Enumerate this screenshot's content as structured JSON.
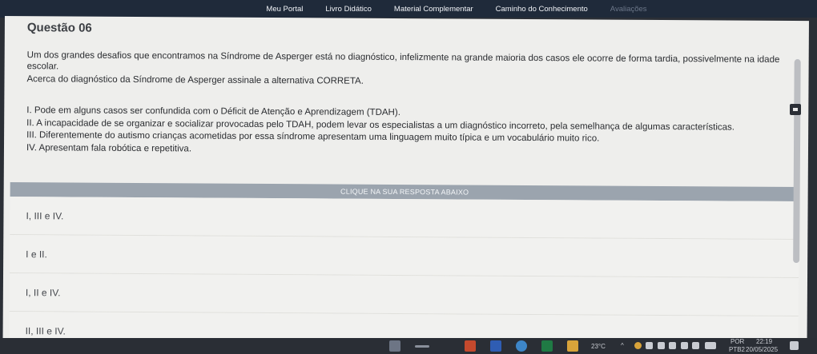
{
  "nav": {
    "items": [
      "Meu Portal",
      "Livro Didático",
      "Material Complementar",
      "Caminho do Conhecimento",
      "Avaliações"
    ]
  },
  "question": {
    "title": "Questão 06",
    "intro": "Um dos grandes desafios que encontramos na Síndrome de Asperger está no diagnóstico, infelizmente na grande maioria dos casos ele ocorre de forma tardia, possivelmente na idade escolar.",
    "prompt": "Acerca do diagnóstico da Síndrome de Asperger assinale a alternativa CORRETA.",
    "statements": [
      "I. Pode em alguns casos ser confundida com o Déficit de Atenção e Aprendizagem (TDAH).",
      "II. A incapacidade de se organizar e socializar provocadas pelo TDAH, podem levar os especialistas a um diagnóstico incorreto, pela semelhança de algumas características.",
      "III. Diferentemente do autismo crianças acometidas por essa síndrome apresentam uma linguagem muito típica e um vocabulário muito rico.",
      "IV. Apresentam fala robótica e repetitiva."
    ]
  },
  "answers": {
    "header": "CLIQUE NA SUA RESPOSTA ABAIXO",
    "options": [
      "I, III e IV.",
      "I e II.",
      "I, II e IV.",
      "II, III e IV."
    ]
  },
  "taskbar": {
    "temperature": "23°C",
    "language": "POR",
    "layout": "PTB2",
    "time": "22:19",
    "date": "20/05/2025"
  },
  "colors": {
    "nav_bg": "#1f2a3a",
    "panel_bg": "#eeeeec",
    "answer_bar": "#9ba4ae",
    "taskbar_bg": "#2a2e35"
  }
}
